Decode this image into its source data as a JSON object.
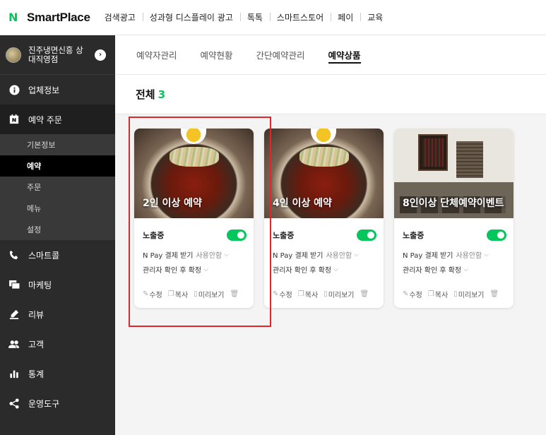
{
  "topbar": {
    "logo_mark": "N",
    "logo_text": "SmartPlace",
    "nav": [
      "검색광고",
      "성과형 디스플레이 광고",
      "톡톡",
      "스마트스토어",
      "페이",
      "교육"
    ]
  },
  "sidebar": {
    "store_name": "진주냉면신흥 상대직영점",
    "menu": [
      {
        "label": "업체정보",
        "icon": "info-icon"
      },
      {
        "label": "예약 주문",
        "icon": "naver-booking-icon"
      },
      {
        "label": "스마트콜",
        "icon": "phone-icon"
      },
      {
        "label": "마케팅",
        "icon": "marketing-icon"
      },
      {
        "label": "리뷰",
        "icon": "pencil-icon"
      },
      {
        "label": "고객",
        "icon": "users-icon"
      },
      {
        "label": "통계",
        "icon": "stats-icon"
      },
      {
        "label": "운영도구",
        "icon": "tools-icon"
      }
    ],
    "submenu": [
      "기본정보",
      "예약",
      "주문",
      "메뉴",
      "설정"
    ]
  },
  "tabs": [
    "예약자관리",
    "예약현황",
    "간단예약관리",
    "예약상품"
  ],
  "total": {
    "label": "전체",
    "count": "3"
  },
  "cards": [
    {
      "title": "2인 이상 예약",
      "status": "노출중",
      "pay_label": "N Pay 결제 받기",
      "pay_value": "사용안함",
      "confirm": "관리자 확인 후 확정",
      "actions": [
        "수정",
        "복사",
        "미리보기"
      ]
    },
    {
      "title": "4인 이상 예약",
      "status": "노출중",
      "pay_label": "N Pay 결제 받기",
      "pay_value": "사용안함",
      "confirm": "관리자 확인 후 확정",
      "actions": [
        "수정",
        "복사",
        "미리보기"
      ]
    },
    {
      "title": "8인이상 단체예약이벤트",
      "status": "노출중",
      "pay_label": "N Pay 결제 받기",
      "pay_value": "사용안함",
      "confirm": "관리자 확인 후 확정",
      "actions": [
        "수정",
        "복사",
        "미리보기"
      ]
    }
  ],
  "colors": {
    "brand": "#03c75a",
    "sidebar": "#2b2b2b",
    "highlight": "#e4262a"
  }
}
